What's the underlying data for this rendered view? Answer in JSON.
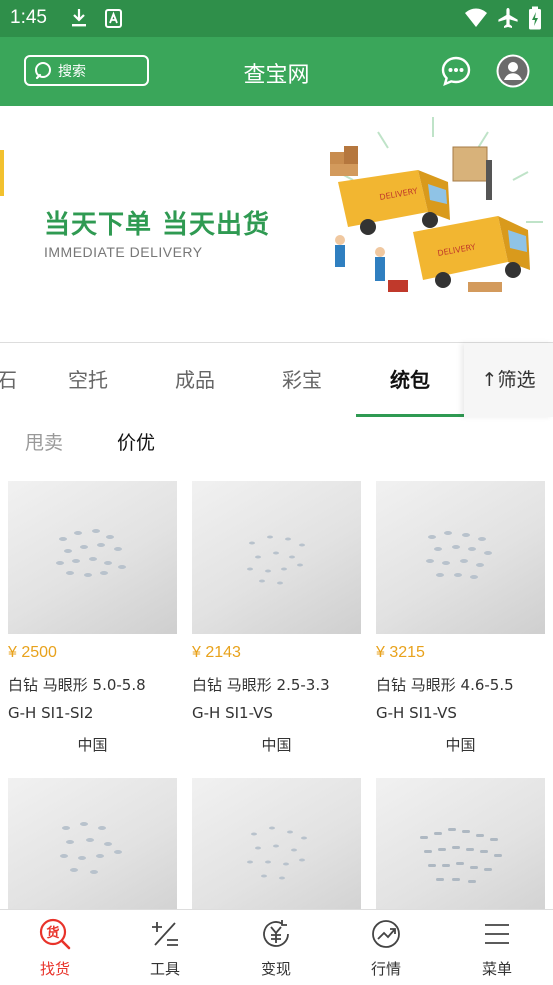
{
  "status": {
    "time": "1:45"
  },
  "header": {
    "search_placeholder": "搜索",
    "title": "查宝网"
  },
  "banner": {
    "title": "当天下单 当天出货",
    "subtitle": "IMMEDIATE DELIVERY",
    "truck_text": "DELIVERY"
  },
  "tabs": {
    "items": [
      "裸石",
      "空托",
      "成品",
      "彩宝",
      "统包"
    ],
    "active_index": 4,
    "filter_label": "↑筛选"
  },
  "subtabs": {
    "items": [
      "甩卖",
      "价优"
    ],
    "active_index": 1
  },
  "products": [
    {
      "price": "¥ 2500",
      "line1": "白钻  马眼形  5.0-5.8",
      "line2": "G-H  SI1-SI2",
      "origin": "中国"
    },
    {
      "price": "¥ 2143",
      "line1": "白钻  马眼形  2.5-3.3",
      "line2": "G-H  SI1-VS",
      "origin": "中国"
    },
    {
      "price": "¥ 3215",
      "line1": "白钻  马眼形  4.6-5.5",
      "line2": "G-H  SI1-VS",
      "origin": "中国"
    },
    {
      "price": "",
      "line1": "",
      "line2": "",
      "origin": ""
    },
    {
      "price": "",
      "line1": "",
      "line2": "",
      "origin": ""
    },
    {
      "price": "",
      "line1": "",
      "line2": "",
      "origin": ""
    }
  ],
  "nav": {
    "items": [
      {
        "label": "找货",
        "icon": "find-goods-icon"
      },
      {
        "label": "工具",
        "icon": "tools-icon"
      },
      {
        "label": "变现",
        "icon": "cash-out-icon"
      },
      {
        "label": "行情",
        "icon": "trend-icon"
      },
      {
        "label": "菜单",
        "icon": "menu-icon"
      }
    ],
    "active_index": 0
  },
  "colors": {
    "brand_green": "#3aa65a",
    "status_green": "#2f8f4a",
    "price_orange": "#e8a21c",
    "nav_active_red": "#e8332a"
  }
}
